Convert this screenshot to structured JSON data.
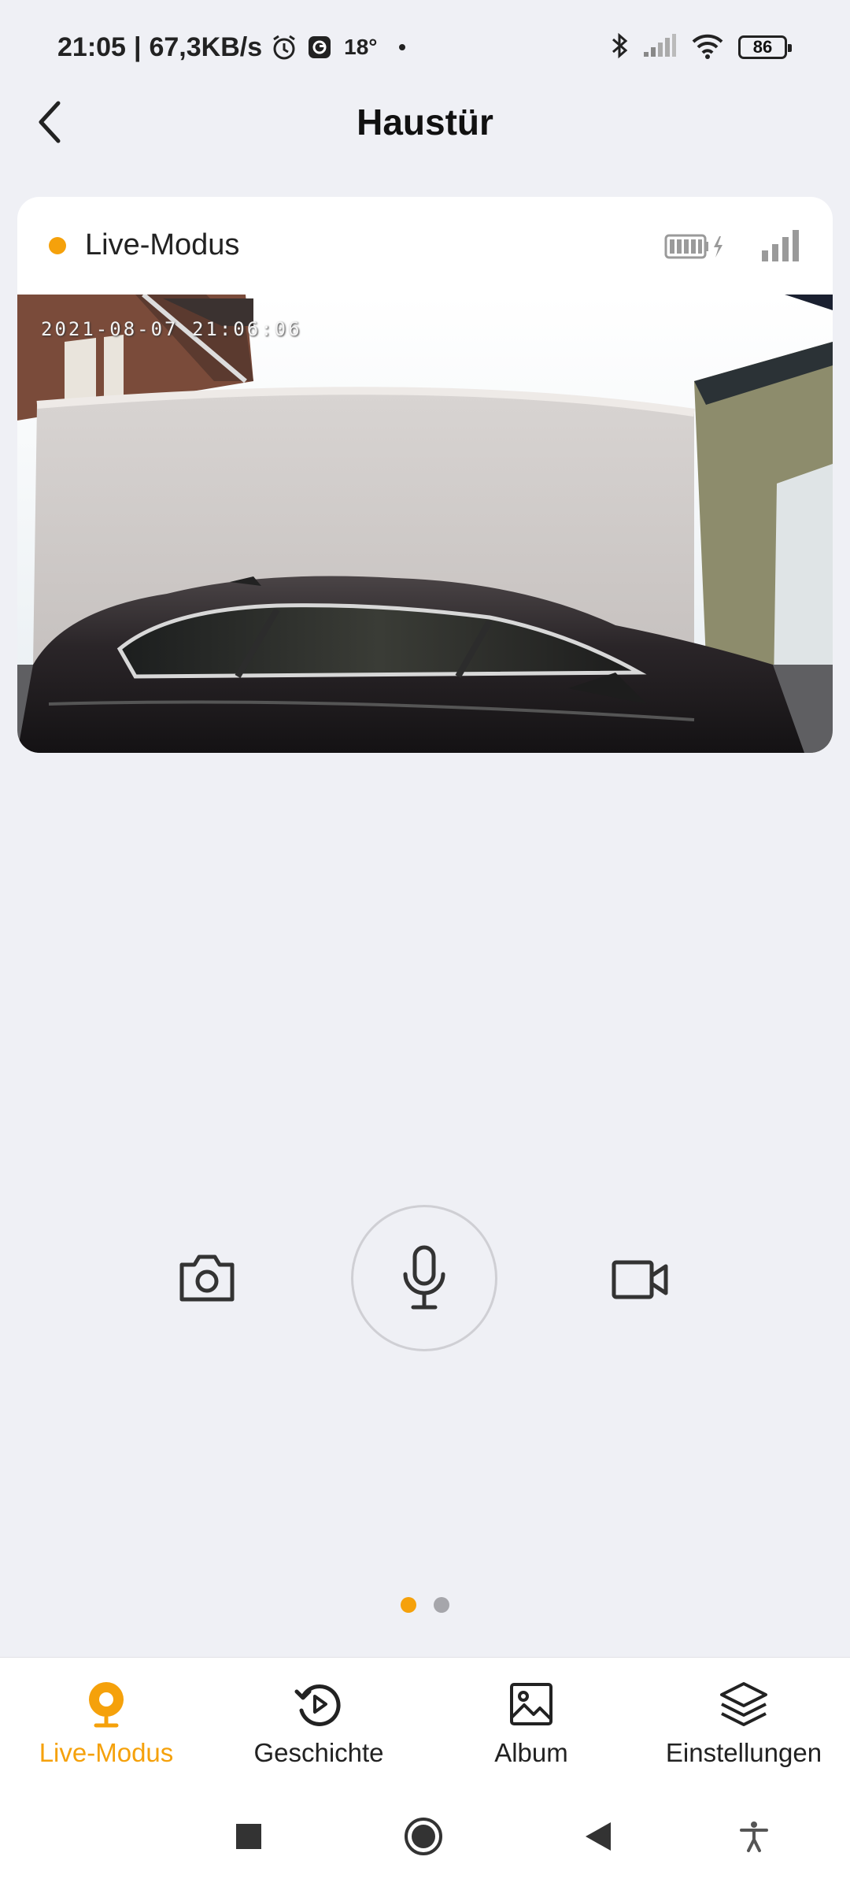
{
  "status_bar": {
    "time": "21:05",
    "separator": "|",
    "net_speed": "67,3KB/s",
    "temperature": "18°",
    "battery": "86",
    "icons": [
      "alarm-icon",
      "app-notification-icon",
      "bluetooth-icon",
      "cell-signal-icon",
      "wifi-icon",
      "battery-icon"
    ]
  },
  "header": {
    "title": "Haustür",
    "back_icon": "chevron-left-icon"
  },
  "camera_card": {
    "mode_label": "Live-Modus",
    "status_color": "#f5a10b",
    "icons": [
      "battery-charging-icon",
      "signal-bars-icon"
    ],
    "video_timestamp": "2021-08-07 21:06:06"
  },
  "controls": {
    "snapshot_icon": "camera-icon",
    "talk_icon": "microphone-icon",
    "record_icon": "video-camera-icon"
  },
  "pager": {
    "count": 2,
    "active_index": 0
  },
  "tabs": [
    {
      "label": "Live-Modus",
      "icon": "live-location-icon",
      "active": true
    },
    {
      "label": "Geschichte",
      "icon": "history-play-icon",
      "active": false
    },
    {
      "label": "Album",
      "icon": "image-icon",
      "active": false
    },
    {
      "label": "Einstellungen",
      "icon": "layers-icon",
      "active": false
    }
  ],
  "nav_bar": {
    "icons": [
      "recents-square-icon",
      "home-circle-icon",
      "back-triangle-icon",
      "accessibility-icon"
    ]
  },
  "colors": {
    "accent": "#f5a10b",
    "background": "#eff0f5"
  }
}
